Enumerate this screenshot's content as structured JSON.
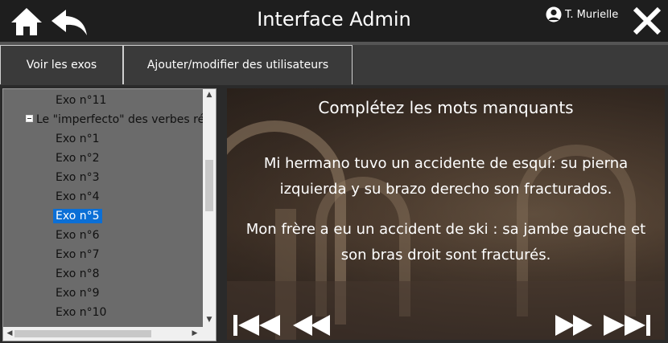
{
  "header": {
    "title": "Interface Admin",
    "user": "T. Murielle",
    "home_icon": "home-icon",
    "back_icon": "back-arrow-icon",
    "close_icon": "close-icon"
  },
  "menu": {
    "tabs": [
      {
        "label": "Voir les exos"
      },
      {
        "label": "Ajouter/modifier des utilisateurs"
      }
    ]
  },
  "tree": {
    "items": [
      {
        "label": "Exo n°11"
      },
      {
        "label": "Le \"imperfecto\" des verbes ré"
      },
      {
        "label": "Exo n°1"
      },
      {
        "label": "Exo n°2"
      },
      {
        "label": "Exo n°3"
      },
      {
        "label": "Exo n°4"
      },
      {
        "label": "Exo n°5",
        "selected": true
      },
      {
        "label": "Exo n°6"
      },
      {
        "label": "Exo n°7"
      },
      {
        "label": "Exo n°8"
      },
      {
        "label": "Exo n°9"
      },
      {
        "label": "Exo n°10"
      }
    ]
  },
  "exercise": {
    "title": "Complétez les mots manquants",
    "spanish_line1": "Mi hermano tuvo un accidente de esquí: su pierna",
    "spanish_line2": "izquierda y su brazo derecho son fracturados.",
    "french_line1": "Mon frère a eu un accident de ski : sa jambe gauche et",
    "french_line2": "son bras droit sont fracturés."
  },
  "colors": {
    "header_bg": "#1e1e1e",
    "menu_bg": "#3a3a3a",
    "tree_bg": "#6b6b6b",
    "selection": "#0b6fd6"
  }
}
